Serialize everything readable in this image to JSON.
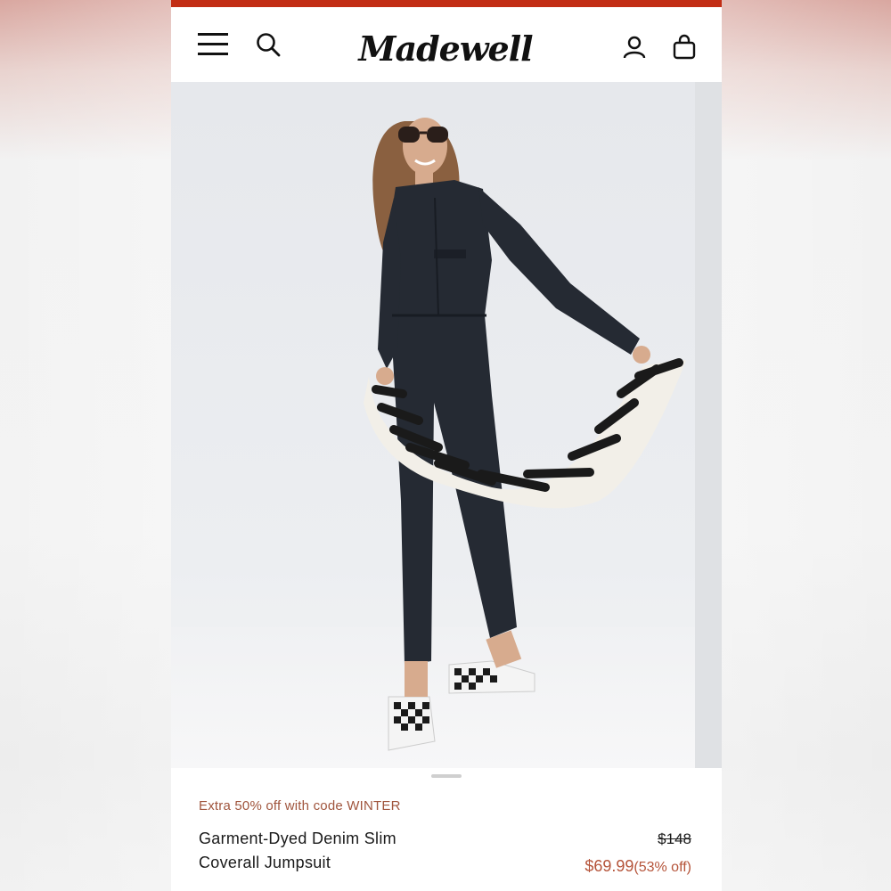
{
  "header": {
    "logo_text": "Madewell",
    "accent_color": "#c22d14",
    "icons": [
      "hamburger-menu-icon",
      "search-icon",
      "account-icon",
      "shopping-bag-icon"
    ]
  },
  "hero": {
    "image_description_icon": "product-photo",
    "carousel_position": 1
  },
  "product": {
    "promo": "Extra 50% off with code WINTER",
    "title_line1": "Garment-Dyed Denim Slim",
    "title_line2": "Coverall Jumpsuit",
    "original_price": "$148",
    "sale_price": "$69.99",
    "discount": "(53% off)",
    "sale_color": "#b5543a"
  }
}
